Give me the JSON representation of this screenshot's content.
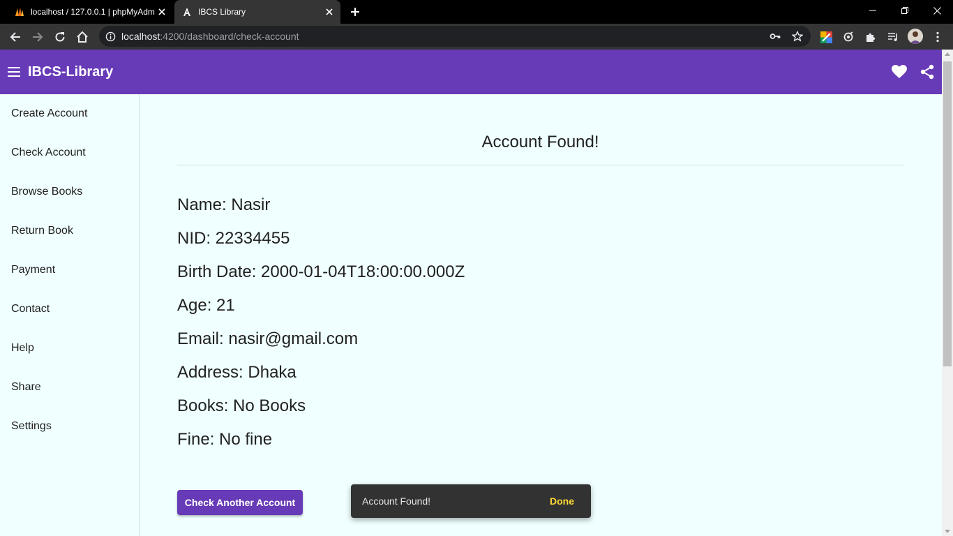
{
  "browser": {
    "tabs": [
      {
        "title": "localhost / 127.0.0.1 | phpMyAdmin",
        "favicon": "phpmyadmin-icon",
        "active": false
      },
      {
        "title": "IBCS Library",
        "favicon": "angular-icon",
        "active": true
      }
    ],
    "url_host": "localhost",
    "url_path": ":4200/dashboard/check-account"
  },
  "app": {
    "title": "IBCS-Library",
    "accent_color": "#673ab7",
    "background_color": "#f0ffff"
  },
  "sidebar": {
    "items": [
      {
        "label": "Create Account"
      },
      {
        "label": "Check Account"
      },
      {
        "label": "Browse Books"
      },
      {
        "label": "Return Book"
      },
      {
        "label": "Payment"
      },
      {
        "label": "Contact"
      },
      {
        "label": "Help"
      },
      {
        "label": "Share"
      },
      {
        "label": "Settings"
      }
    ]
  },
  "account": {
    "heading": "Account Found!",
    "fields": [
      {
        "label": "Name: ",
        "value": "Nasir"
      },
      {
        "label": "NID: ",
        "value": "22334455"
      },
      {
        "label": "Birth Date: ",
        "value": "2000-01-04T18:00:00.000Z"
      },
      {
        "label": "Age: ",
        "value": "21"
      },
      {
        "label": "Email: ",
        "value": "nasir@gmail.com"
      },
      {
        "label": "Address: ",
        "value": "Dhaka"
      },
      {
        "label": "Books: ",
        "value": "No Books"
      },
      {
        "label": "Fine: ",
        "value": "No fine"
      }
    ],
    "check_another_label": "Check Another Account"
  },
  "snackbar": {
    "message": "Account Found!",
    "action": "Done",
    "action_color": "#fdd835"
  }
}
